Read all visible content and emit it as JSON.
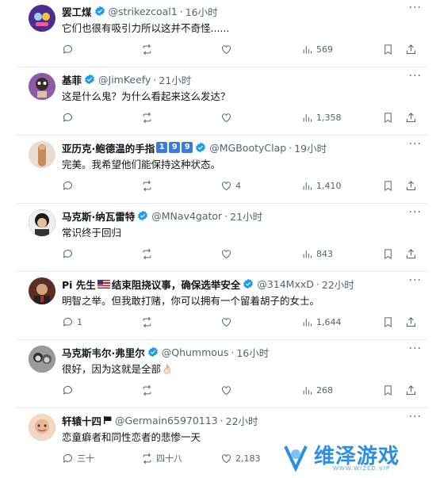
{
  "tweets": [
    {
      "name": "罢工煤",
      "handle": "@strikezcoal1",
      "time": "16小时",
      "text": "它们也很有吸引力所以这并不奇怪......",
      "reply": "",
      "retweet": "",
      "like": "",
      "views": "569",
      "avatar_color": "#5b3fa3"
    },
    {
      "name": "基菲",
      "handle": "@JimKeefy",
      "time": "21小时",
      "text": "这是什么鬼？为什么看起来这么发达？",
      "reply": "",
      "retweet": "",
      "like": "",
      "views": "1,358",
      "avatar_color": "#7a4a8f"
    },
    {
      "name": "亚历克·鲍德温的手指",
      "handle": "@MGBootyClap",
      "time": "19小时",
      "name_badges": [
        "1",
        "9",
        "9"
      ],
      "text": "完美。我希望他们能保持这种状态。",
      "reply": "",
      "retweet": "",
      "like": "4",
      "views": "1,410",
      "avatar_color": "#c98a5a"
    },
    {
      "name": "马克斯·纳瓦雷特",
      "handle": "@MNav4gator",
      "time": "21小时",
      "text": "常识终于回归",
      "reply": "",
      "retweet": "",
      "like": "",
      "views": "843",
      "avatar_color": "#2b2b2b"
    },
    {
      "name_prefix": "Pi 先生",
      "name": "结束阻挠议事，确保选举安全",
      "handle": "@314MxxD",
      "time": "22小时",
      "text": "明智之举。但我敢打赌，你可以拥有一个留着胡子的女士。",
      "reply": "1",
      "retweet": "",
      "like": "",
      "views": "1,644",
      "avatar_color": "#6b3a2a"
    },
    {
      "name": "马克斯韦尔·弗里尔",
      "handle": "@Qhummous",
      "time": "16小时",
      "text": "很好，因为这就是全部👌🏻",
      "reply": "",
      "retweet": "",
      "like": "",
      "views": "268",
      "avatar_color": "#444444"
    },
    {
      "name": "轩辕十四",
      "handle": "@Germain65970113",
      "time": "22小时",
      "text": "恋童癖者和同性恋者的悲惨一天",
      "reply": "三十",
      "retweet": "四十八",
      "like": "2,183",
      "views": "",
      "avatar_color": "#d9a88a"
    }
  ],
  "watermark": {
    "text": "维泽游戏",
    "sub": "WWW.WIZED.VIP"
  },
  "colors": {
    "verified": "#1d9bf0",
    "muted": "#536471",
    "watermark": "#2d8fe0"
  }
}
